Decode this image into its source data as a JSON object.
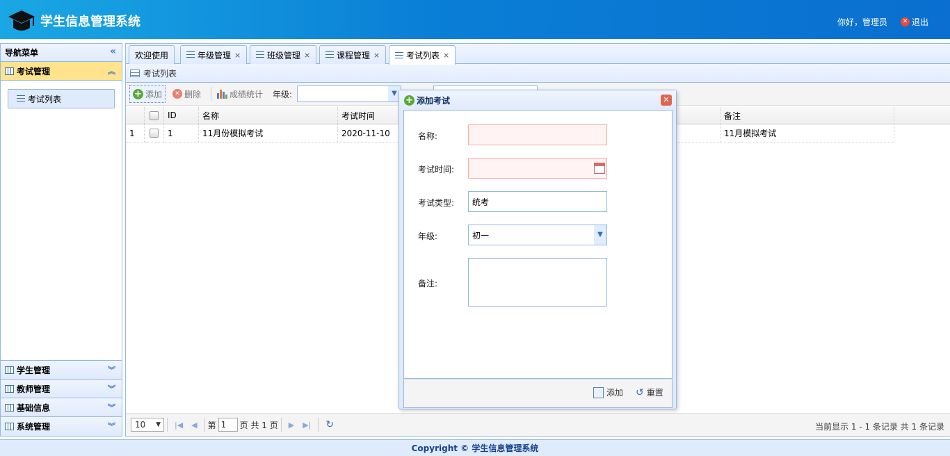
{
  "header": {
    "title": "学生信息管理系统",
    "greeting": "你好，管理员",
    "logout": "退出"
  },
  "sidebar": {
    "title": "导航菜单",
    "active_group": "考试管理",
    "active_items": [
      "考试列表"
    ],
    "groups": [
      "学生管理",
      "教师管理",
      "基础信息",
      "系统管理"
    ]
  },
  "tabs": [
    {
      "label": "欢迎使用"
    },
    {
      "label": "年级管理"
    },
    {
      "label": "班级管理"
    },
    {
      "label": "课程管理"
    },
    {
      "label": "考试列表"
    }
  ],
  "panel": {
    "title": "考试列表"
  },
  "toolbar": {
    "add": "添加",
    "delete": "删除",
    "stats": "成绩统计",
    "grade_label": "年级:"
  },
  "table": {
    "columns": [
      "ID",
      "名称",
      "考试时间",
      "备注"
    ],
    "rows": [
      {
        "num": "1",
        "id": "1",
        "name": "11月份模拟考试",
        "date": "2020-11-10",
        "note": "11月模拟考试"
      }
    ]
  },
  "pager": {
    "page_size": "10",
    "page_label": "第",
    "page_value": "1",
    "page_total": "页 共 1 页",
    "info": "当前显示 1 - 1 条记录 共 1 条记录"
  },
  "dialog": {
    "title": "添加考试",
    "fields": {
      "name_label": "名称:",
      "time_label": "考试时间:",
      "type_label": "考试类型:",
      "type_value": "统考",
      "grade_label": "年级:",
      "grade_value": "初一",
      "note_label": "备注:"
    },
    "add_button": "添加",
    "reset_button": "重置"
  },
  "footer": {
    "copyright": "Copyright © 学生信息管理系统"
  }
}
